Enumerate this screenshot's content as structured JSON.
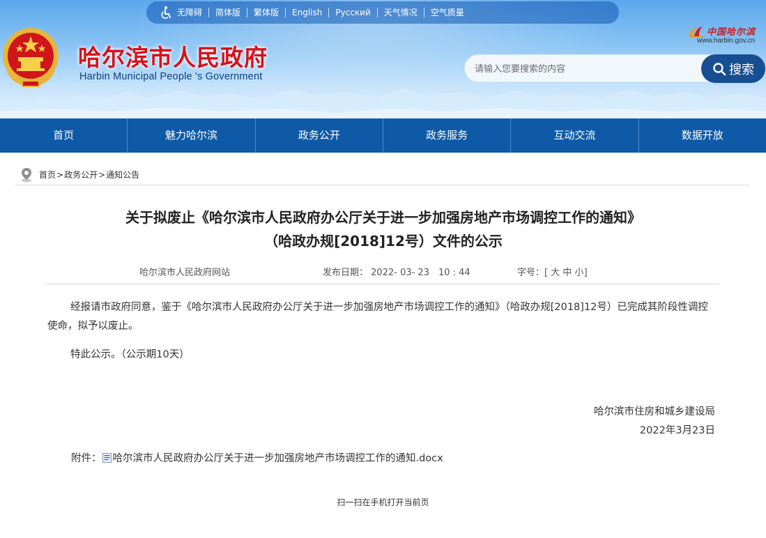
{
  "topbar": {
    "links": [
      "无障碍",
      "简体版",
      "繁体版",
      "English",
      "Русский",
      "天气情况",
      "空气质量"
    ]
  },
  "site": {
    "title_cn": "哈尔滨市人民政府",
    "title_en": "Harbin Municipal People 's Government"
  },
  "city_logo": {
    "name": "中国哈尔滨",
    "url": "www.harbin.gov.cn"
  },
  "search": {
    "placeholder": "请输入您要搜索的内容",
    "button_label": "搜索"
  },
  "nav": {
    "items": [
      "首页",
      "魅力哈尔滨",
      "政务公开",
      "政务服务",
      "互动交流",
      "数据开放"
    ]
  },
  "breadcrumb": {
    "items": [
      "首页",
      "政务公开",
      "通知公告"
    ],
    "separator": ">"
  },
  "article": {
    "title_line1": "关于拟废止《哈尔滨市人民政府办公厅关于进一步加强房地产市场调控工作的通知》",
    "title_line2": "（哈政办规[2018]12号）文件的公示",
    "source": "哈尔滨市人民政府网站",
    "date_label": "发布日期：",
    "date_value": "2022- 03- 23　10 : 44",
    "font_size_label": "字号：",
    "font_size_open": "[",
    "font_size_large": "大",
    "font_size_medium": "中",
    "font_size_small": "小",
    "font_size_close": "]",
    "paragraph1": "经报请市政府同意，鉴于《哈尔滨市人民政府办公厅关于进一步加强房地产市场调控工作的通知》（哈政办规[2018]12号）已完成其阶段性调控使命，拟予以废止。",
    "paragraph2": "特此公示。（公示期10天）",
    "signature_org": "哈尔滨市住房和城乡建设局",
    "signature_date": "2022年3月23日",
    "attachment_label": "附件：",
    "attachment_name": "哈尔滨市人民政府办公厅关于进一步加强房地产市场调控工作的通知.docx"
  },
  "footer": {
    "qr_text": "扫一扫在手机打开当前页"
  },
  "colors": {
    "nav_bg": "#0e5aa7",
    "title_red": "#d6111a",
    "search_button": "#184f92"
  }
}
